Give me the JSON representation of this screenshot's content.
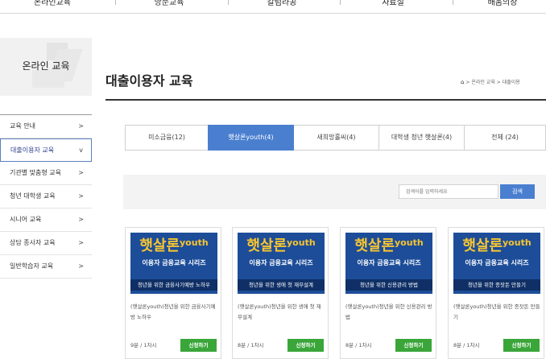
{
  "topnav": {
    "items": [
      "온라인교육",
      "방문교육",
      "칼럼라공",
      "자료실",
      "배움의장"
    ]
  },
  "sidebar": {
    "title": "온라인 교육",
    "items": [
      {
        "label": "교육 안내",
        "chev": ">"
      },
      {
        "label": "대출이용자 교육",
        "chev": "v"
      },
      {
        "label": "기관별 맞춤형 교육",
        "chev": ">"
      },
      {
        "label": "청년 대학생 교육",
        "chev": ">"
      },
      {
        "label": "시니어 교육",
        "chev": ">"
      },
      {
        "label": "상담 종사자 교육",
        "chev": ">"
      },
      {
        "label": "일반학습자 교육",
        "chev": ">"
      }
    ]
  },
  "page": {
    "title": "대출이용자 교육",
    "breadcrumb": {
      "home_icon": "home-icon",
      "sep": ">",
      "level1": "온라인 교육",
      "level2": "대출이용"
    }
  },
  "tabs": [
    {
      "label": "미소금융(12)"
    },
    {
      "label": "햇살론youth(4)"
    },
    {
      "label": "새희망홀씨(4)"
    },
    {
      "label": "대학생 청년 햇살론(4)"
    },
    {
      "label": "전체 (24)"
    }
  ],
  "search": {
    "placeholder": "검색어를 입력하세요",
    "button_label": "검색"
  },
  "cards": [
    {
      "brand_ko": "햇살론",
      "brand_en": "youth",
      "series": "이용자 금융교육 시리즈",
      "strip": "청년을 위한 금융사기예방 노하우",
      "desc": "(햇살론youth)청년을 위한 금융사기예방 노하우",
      "meta": "9분 / 1차시",
      "apply": "신청하기"
    },
    {
      "brand_ko": "햇살론",
      "brand_en": "youth",
      "series": "이용자 금융교육 시리즈",
      "strip": "청년을 위한 생애 첫 재무설계",
      "desc": "(햇살론youth)청년을 위한 생애 첫 재무설계",
      "meta": "8분 / 1차시",
      "apply": "신청하기"
    },
    {
      "brand_ko": "햇살론",
      "brand_en": "youth",
      "series": "이용자 금융교육 시리즈",
      "strip": "청년을 위한 신용관리 방법",
      "desc": "(햇살론youth)청년을 위한 신용관리 방법",
      "meta": "8분 / 1차시",
      "apply": "신청하기"
    },
    {
      "brand_ko": "햇살론",
      "brand_en": "youth",
      "series": "이용자 금융교육 시리즈",
      "strip": "청년을 위한 종잣돈 만들기",
      "desc": "(햇살론youth)청년을 위한 종잣돈 만들기",
      "meta": "8분 / 1차시",
      "apply": "신청하기"
    }
  ],
  "colors": {
    "accent_blue": "#4a7fd0",
    "card_navy": "#1d4d99",
    "brand_yellow": "#f7c531",
    "apply_green": "#3aa63a"
  }
}
